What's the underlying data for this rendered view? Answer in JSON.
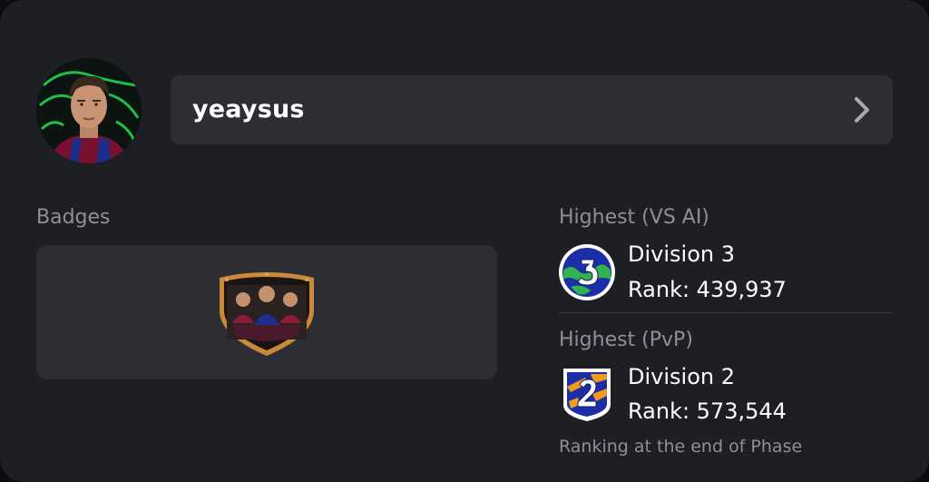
{
  "profile": {
    "username": "yeaysus",
    "avatar_icon": "player-portrait"
  },
  "badges": {
    "label": "Badges",
    "items": [
      {
        "icon": "club-crest-badge"
      }
    ]
  },
  "rankings": [
    {
      "label": "Highest (VS AI)",
      "division": "Division 3",
      "rank": "Rank: 439,937",
      "icon": "division-3-vs-ai-icon"
    },
    {
      "label": "Highest (PvP)",
      "division": "Division 2",
      "rank": "Rank: 573,544",
      "icon": "division-2-pvp-icon"
    }
  ],
  "footnote": "Ranking at the end of Phase",
  "colors": {
    "card_bg": "#1e1f24",
    "panel_bg": "#2d2e34",
    "muted_text": "#8f9097",
    "division_blue": "#1d2fa8",
    "division_green": "#2fb44e",
    "division_orange": "#f39a1e"
  }
}
